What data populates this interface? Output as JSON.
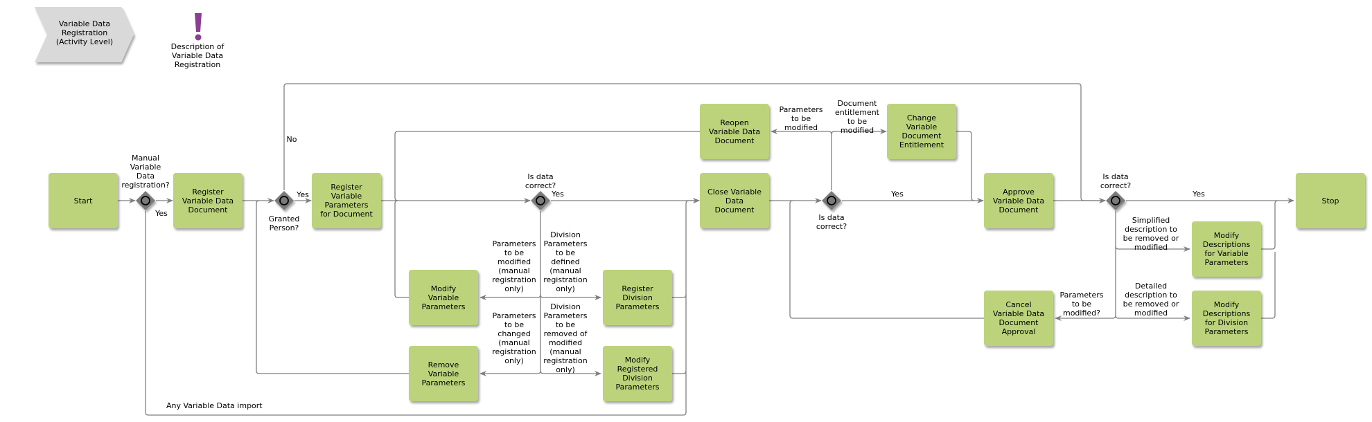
{
  "header": {
    "process_interface": "Variable Data\nRegistration\n(Activity Level)",
    "description_label": "Description of\nVariable Data\nRegistration"
  },
  "colors": {
    "activity": "#bcd37b",
    "gateway": "#7a7a7a",
    "connector": "#7f7f7f",
    "interface": "#d9d9da",
    "exclamation": "#8a3f91"
  },
  "nodes": {
    "start": "Start",
    "register_vdd": "Register\nVariable Data\nDocument",
    "register_vp": "Register\nVariable\nParameters\nfor Document",
    "modify_vp": "Modify\nVariable\nParameters",
    "remove_vp": "Remove\nVariable\nParameters",
    "register_dp": "Register\nDivision\nParameters",
    "modify_rdp": "Modify\nRegistered\nDivision\nParameters",
    "reopen": "Reopen\nVariable Data\nDocument",
    "close": "Close Variable\nData\nDocument",
    "change_entitlement": "Change\nVariable\nDocument\nEntitlement",
    "approve": "Approve\nVariable Data\nDocument",
    "cancel_approval": "Cancel\nVariable Data\nDocument\nApproval",
    "modify_desc_vp": "Modify\nDescriptions\nfor Variable\nParameters",
    "modify_desc_dp": "Modify\nDescriptions\nfor Division\nParameters",
    "stop": "Stop"
  },
  "gateways": {
    "g1": "Manual\nVariable\nData\nregistration?",
    "g2": "Granted\nPerson?",
    "g3": "Is data\ncorrect?",
    "g4": "Is data\ncorrect?",
    "g5": "Is data\ncorrect?"
  },
  "edge_labels": {
    "g1_yes": "Yes",
    "g2_yes": "Yes",
    "g2_no": "No",
    "g3_yes": "Yes",
    "params_modified_manual": "Parameters\nto be\nmodified\n(manual\nregistration\nonly)",
    "division_defined_manual": "Division\nParameters\nto be\ndefined\n(manual\nregistration\nonly)",
    "params_changed_manual": "Parameters\nto be\nchanged\n(manual\nregistration\nonly)",
    "division_removed_manual": "Division\nParameters\nto be\nremoved of\nmodified\n(manual\nregistration\nonly)",
    "any_import": "Any Variable Data import",
    "params_to_be_modified": "Parameters\nto be\nmodified",
    "entitlement_modified": "Document\nentitlement\nto be\nmodified",
    "g4_yes": "Yes",
    "g5_yes": "Yes",
    "simplified_desc": "Simplified\ndescription to\nbe removed or\nmodified",
    "detailed_desc": "Detailed\ndescription to\nbe removed or\nmodified",
    "params_modified_q": "Parameters\nto be\nmodified?"
  }
}
